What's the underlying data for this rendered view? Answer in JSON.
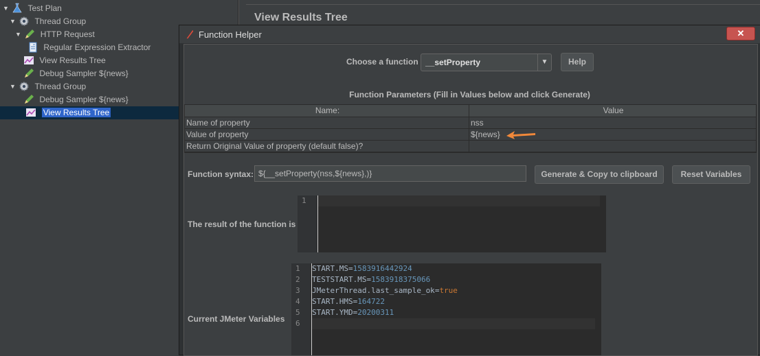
{
  "tree": {
    "items": [
      {
        "label": "Test Plan",
        "icon": "flask-icon"
      },
      {
        "label": "Thread Group",
        "icon": "gear-icon"
      },
      {
        "label": "HTTP Request",
        "icon": "pencil-icon"
      },
      {
        "label": "Regular Expression Extractor",
        "icon": "document-icon"
      },
      {
        "label": "View Results Tree",
        "icon": "chart-icon"
      },
      {
        "label": "Debug Sampler ${news}",
        "icon": "pencil-icon"
      },
      {
        "label": "Thread Group",
        "icon": "gear-icon"
      },
      {
        "label": "Debug Sampler ${news}",
        "icon": "pencil-icon"
      },
      {
        "label": "View Results Tree",
        "icon": "chart-icon"
      }
    ]
  },
  "background_panel": {
    "title": "View Results Tree"
  },
  "dialog": {
    "title": "Function Helper",
    "close_label": "✕",
    "choose_label": "Choose a function",
    "selected_function": "__setProperty",
    "help_label": "Help",
    "params_caption": "Function Parameters (Fill in Values below and click Generate)",
    "params_table": {
      "headers": [
        "Name:",
        "Value"
      ],
      "rows": [
        {
          "name": "Name of property",
          "value": "nss"
        },
        {
          "name": "Value of property",
          "value": "${news}"
        },
        {
          "name": "Return Original Value of property (default false)?",
          "value": ""
        }
      ]
    },
    "syntax_label": "Function syntax:",
    "syntax_value": "${__setProperty(nss,${news},)}",
    "generate_label": "Generate & Copy to clipboard",
    "reset_label": "Reset Variables",
    "result_label": "The result of the function is",
    "result_lines": [
      "1"
    ],
    "variables_label": "Current JMeter Variables",
    "variables": [
      {
        "ln": "1",
        "key": "START.MS",
        "val": "1583916442924"
      },
      {
        "ln": "2",
        "key": "TESTSTART.MS",
        "val": "1583918375066"
      },
      {
        "ln": "3",
        "key": "JMeterThread.last_sample_ok",
        "val": "true"
      },
      {
        "ln": "4",
        "key": "START.HMS",
        "val": "164722"
      },
      {
        "ln": "5",
        "key": "START.YMD",
        "val": "20200311"
      },
      {
        "ln": "6",
        "key": "",
        "val": ""
      }
    ]
  },
  "colors": {
    "accent_arrow": "#f0883a",
    "selection": "#2f65ca"
  }
}
